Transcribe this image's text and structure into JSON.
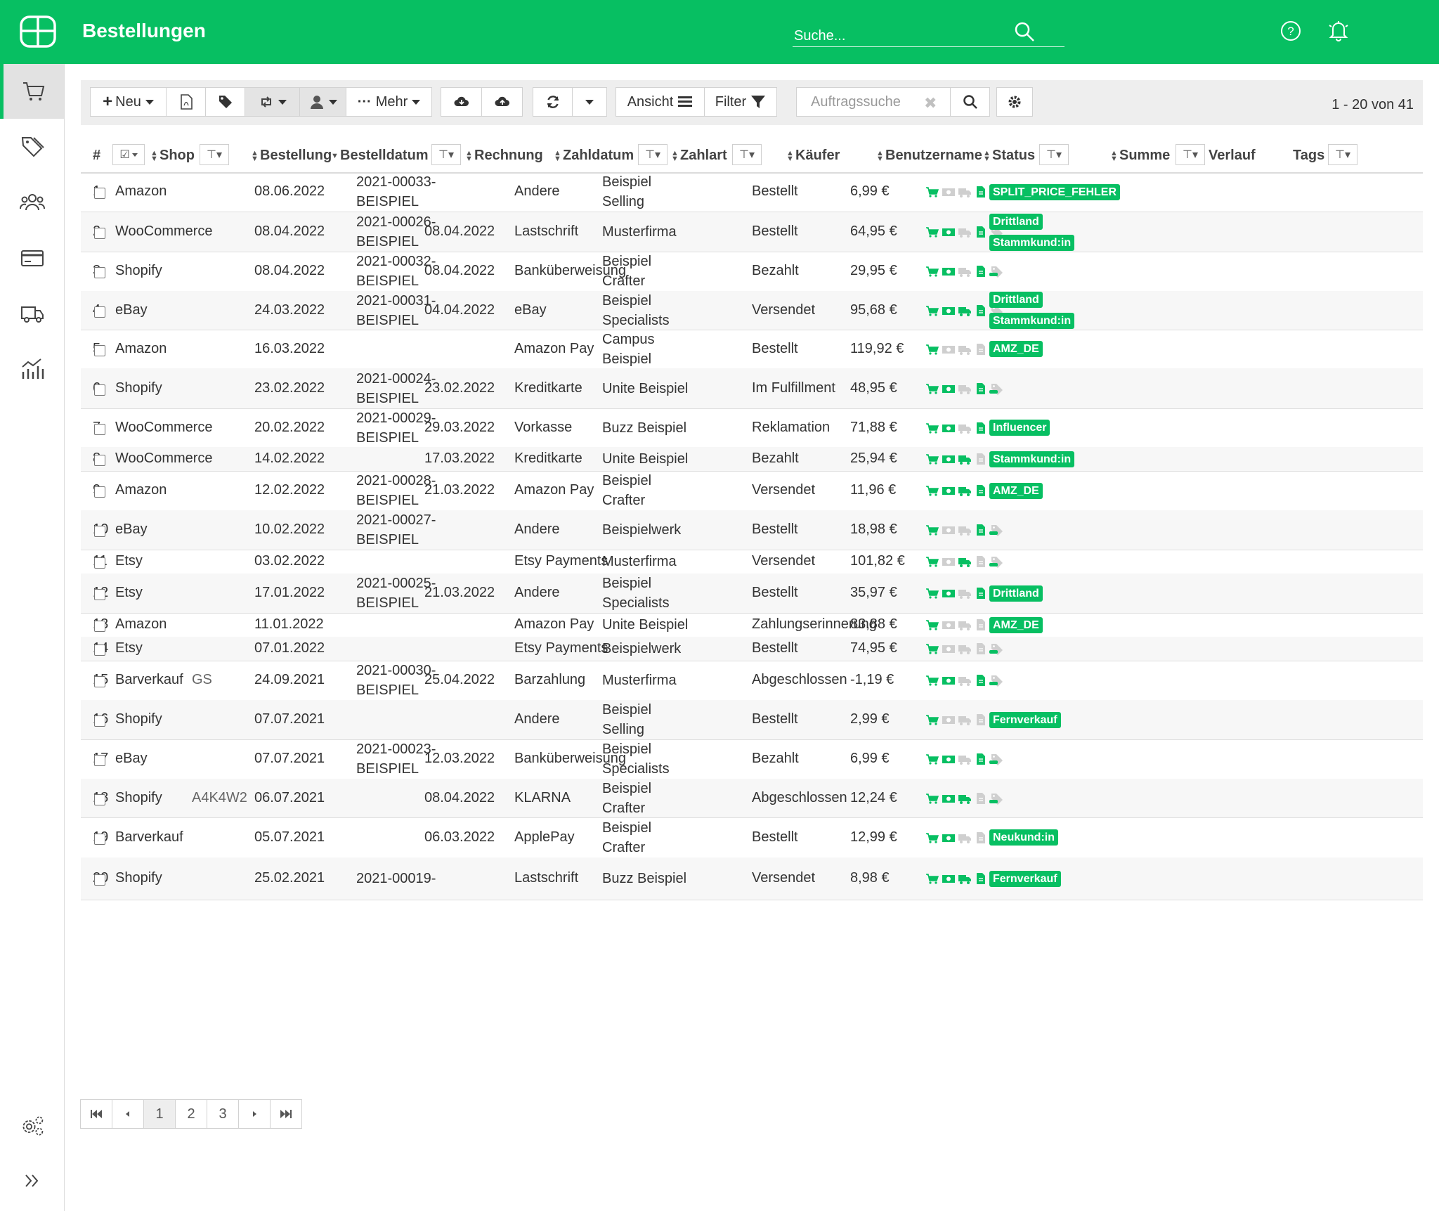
{
  "header": {
    "title": "Bestellungen",
    "search_placeholder": "Suche...",
    "brand_color": "#07bf62"
  },
  "sidebar": {
    "items": [
      "cart-icon",
      "tags-icon",
      "customers-icon",
      "payment-card-icon",
      "shipping-truck-icon",
      "analytics-icon"
    ],
    "bottom": [
      "settings-gears-icon",
      "expand-chevrons-icon"
    ]
  },
  "toolbar": {
    "new_label": "Neu",
    "more_label": "Mehr",
    "view_label": "Ansicht",
    "filter_label": "Filter",
    "order_search_placeholder": "Auftragssuche",
    "page_info": "1 - 20 von 41"
  },
  "columns": {
    "num": "#",
    "shop": "Shop",
    "order": "Bestellung",
    "order_date": "Bestelldatum",
    "invoice": "Rechnung",
    "pay_date": "Zahldatum",
    "pay_method": "Zahlart",
    "buyer": "Käufer",
    "username": "Benutzername",
    "status": "Status",
    "sum": "Summe",
    "history": "Verlauf",
    "tags": "Tags"
  },
  "rows": [
    {
      "n": "1",
      "shop": "Amazon",
      "order": "",
      "date": "08.06.2022",
      "inv1": "2021-00033-",
      "inv2": "BEISPIEL",
      "paydate": "",
      "method": "Andere",
      "buyer1": "Beispiel",
      "buyer2": "Selling",
      "user": "",
      "status": "Bestellt",
      "sum": "6,99 €",
      "v": [
        1,
        0,
        0,
        1,
        0
      ],
      "tags": [
        "SPLIT_PRICE_FEHLER"
      ]
    },
    {
      "n": "2",
      "shop": "WooCommerce",
      "order": "",
      "date": "08.04.2022",
      "inv1": "2021-00026-",
      "inv2": "BEISPIEL",
      "paydate": "08.04.2022",
      "method": "Lastschrift",
      "buyer1": "Musterfirma",
      "buyer2": "",
      "user": "",
      "status": "Bestellt",
      "sum": "64,95 €",
      "v": [
        1,
        1,
        0,
        1,
        0
      ],
      "tags": [
        "Drittland",
        "Stammkund:in"
      ]
    },
    {
      "n": "3",
      "shop": "Shopify",
      "order": "",
      "date": "08.04.2022",
      "inv1": "2021-00032-",
      "inv2": "BEISPIEL",
      "paydate": "08.04.2022",
      "method": "Banküberweisung",
      "buyer1": "Beispiel",
      "buyer2": "Crafter",
      "user": "",
      "status": "Bezahlt",
      "sum": "29,95 €",
      "v": [
        1,
        1,
        0,
        1,
        0
      ],
      "tags": []
    },
    {
      "n": "4",
      "shop": "eBay",
      "order": "",
      "date": "24.03.2022",
      "inv1": "2021-00031-",
      "inv2": "BEISPIEL",
      "paydate": "04.04.2022",
      "method": "eBay",
      "buyer1": "Beispiel",
      "buyer2": "Specialists",
      "user": "",
      "status": "Versendet",
      "sum": "95,68 €",
      "v": [
        1,
        1,
        1,
        1,
        0
      ],
      "tags": [
        "Drittland",
        "Stammkund:in"
      ]
    },
    {
      "n": "5",
      "shop": "Amazon",
      "order": "",
      "date": "16.03.2022",
      "inv1": "",
      "inv2": "",
      "paydate": "",
      "method": "Amazon Pay",
      "buyer1": "Campus",
      "buyer2": "Beispiel",
      "user": "",
      "status": "Bestellt",
      "sum": "119,92 €",
      "v": [
        1,
        0,
        0,
        0,
        0
      ],
      "tags": [
        "AMZ_DE"
      ]
    },
    {
      "n": "6",
      "shop": "Shopify",
      "order": "",
      "date": "23.02.2022",
      "inv1": "2021-00024-",
      "inv2": "BEISPIEL",
      "paydate": "23.02.2022",
      "method": "Kreditkarte",
      "buyer1": "Unite Beispiel",
      "buyer2": "",
      "user": "",
      "status": "Im Fulfillment",
      "sum": "48,95 €",
      "v": [
        1,
        1,
        0,
        1,
        0
      ],
      "tags": []
    },
    {
      "n": "7",
      "shop": "WooCommerce",
      "order": "",
      "date": "20.02.2022",
      "inv1": "2021-00029-",
      "inv2": "BEISPIEL",
      "paydate": "29.03.2022",
      "method": "Vorkasse",
      "buyer1": "Buzz Beispiel",
      "buyer2": "",
      "user": "",
      "status": "Reklamation",
      "sum": "71,88 €",
      "v": [
        1,
        1,
        0,
        1,
        0
      ],
      "tags": [
        "Influencer"
      ]
    },
    {
      "n": "8",
      "shop": "WooCommerce",
      "order": "",
      "date": "14.02.2022",
      "inv1": "",
      "inv2": "",
      "paydate": "17.03.2022",
      "method": "Kreditkarte",
      "buyer1": "Unite Beispiel",
      "buyer2": "",
      "user": "",
      "status": "Bezahlt",
      "sum": "25,94 €",
      "v": [
        1,
        1,
        1,
        0,
        0
      ],
      "tags": [
        "Stammkund:in"
      ]
    },
    {
      "n": "9",
      "shop": "Amazon",
      "order": "",
      "date": "12.02.2022",
      "inv1": "2021-00028-",
      "inv2": "BEISPIEL",
      "paydate": "21.03.2022",
      "method": "Amazon Pay",
      "buyer1": "Beispiel",
      "buyer2": "Crafter",
      "user": "",
      "status": "Versendet",
      "sum": "11,96 €",
      "v": [
        1,
        1,
        1,
        1,
        0
      ],
      "tags": [
        "AMZ_DE"
      ]
    },
    {
      "n": "10",
      "shop": "eBay",
      "order": "",
      "date": "10.02.2022",
      "inv1": "2021-00027-",
      "inv2": "BEISPIEL",
      "paydate": "",
      "method": "Andere",
      "buyer1": "Beispielwerk",
      "buyer2": "",
      "user": "",
      "status": "Bestellt",
      "sum": "18,98 €",
      "v": [
        1,
        0,
        0,
        1,
        0
      ],
      "tags": []
    },
    {
      "n": "11",
      "shop": "Etsy",
      "order": "",
      "date": "03.02.2022",
      "inv1": "",
      "inv2": "",
      "paydate": "",
      "method": "Etsy Payments",
      "buyer1": "Musterfirma",
      "buyer2": "",
      "user": "",
      "status": "Versendet",
      "sum": "101,82 €",
      "v": [
        1,
        0,
        1,
        0,
        0
      ],
      "tags": []
    },
    {
      "n": "12",
      "shop": "Etsy",
      "order": "",
      "date": "17.01.2022",
      "inv1": "2021-00025-",
      "inv2": "BEISPIEL",
      "paydate": "21.03.2022",
      "method": "Andere",
      "buyer1": "Beispiel",
      "buyer2": "Specialists",
      "user": "",
      "status": "Bestellt",
      "sum": "35,97 €",
      "v": [
        1,
        1,
        0,
        1,
        0
      ],
      "tags": [
        "Drittland"
      ]
    },
    {
      "n": "13",
      "shop": "Amazon",
      "order": "",
      "date": "11.01.2022",
      "inv1": "",
      "inv2": "",
      "paydate": "",
      "method": "Amazon Pay",
      "buyer1": "Unite Beispiel",
      "buyer2": "",
      "user": "",
      "status": "Zahlungserinnerung",
      "sum": "83,88 €",
      "v": [
        1,
        0,
        0,
        0,
        0
      ],
      "tags": [
        "AMZ_DE"
      ]
    },
    {
      "n": "14",
      "shop": "Etsy",
      "order": "",
      "date": "07.01.2022",
      "inv1": "",
      "inv2": "",
      "paydate": "",
      "method": "Etsy Payments",
      "buyer1": "Beispielwerk",
      "buyer2": "",
      "user": "",
      "status": "Bestellt",
      "sum": "74,95 €",
      "v": [
        1,
        0,
        0,
        0,
        0
      ],
      "tags": []
    },
    {
      "n": "15",
      "shop": "Barverkauf",
      "order": "GS",
      "date": "24.09.2021",
      "inv1": "2021-00030-",
      "inv2": "BEISPIEL",
      "paydate": "25.04.2022",
      "method": "Barzahlung",
      "buyer1": "Musterfirma",
      "buyer2": "",
      "user": "",
      "status": "Abgeschlossen",
      "sum": "-1,19 €",
      "v": [
        1,
        1,
        0,
        1,
        0
      ],
      "tags": []
    },
    {
      "n": "16",
      "shop": "Shopify",
      "order": "",
      "date": "07.07.2021",
      "inv1": "",
      "inv2": "",
      "paydate": "",
      "method": "Andere",
      "buyer1": "Beispiel",
      "buyer2": "Selling",
      "user": "",
      "status": "Bestellt",
      "sum": "2,99 €",
      "v": [
        1,
        0,
        0,
        0,
        0
      ],
      "tags": [
        "Fernverkauf"
      ]
    },
    {
      "n": "17",
      "shop": "eBay",
      "order": "",
      "date": "07.07.2021",
      "inv1": "2021-00023-",
      "inv2": "BEISPIEL",
      "paydate": "12.03.2022",
      "method": "Banküberweisung",
      "buyer1": "Beispiel",
      "buyer2": "Specialists",
      "user": "",
      "status": "Bezahlt",
      "sum": "6,99 €",
      "v": [
        1,
        1,
        0,
        1,
        0
      ],
      "tags": []
    },
    {
      "n": "18",
      "shop": "Shopify",
      "order": "A4K4W2",
      "date": "06.07.2021",
      "inv1": "",
      "inv2": "",
      "paydate": "08.04.2022",
      "method": "KLARNA",
      "buyer1": "Beispiel",
      "buyer2": "Crafter",
      "user": "",
      "status": "Abgeschlossen",
      "sum": "12,24 €",
      "v": [
        1,
        1,
        1,
        0,
        0
      ],
      "tags": []
    },
    {
      "n": "19",
      "shop": "Barverkauf",
      "order": "",
      "date": "05.07.2021",
      "inv1": "",
      "inv2": "",
      "paydate": "06.03.2022",
      "method": "ApplePay",
      "buyer1": "Beispiel",
      "buyer2": "Crafter",
      "user": "",
      "status": "Bestellt",
      "sum": "12,99 €",
      "v": [
        1,
        1,
        0,
        0,
        0
      ],
      "tags": [
        "Neukund:in"
      ]
    },
    {
      "n": "20",
      "shop": "Shopify",
      "order": "",
      "date": "25.02.2021",
      "inv1": "2021-00019-",
      "inv2": "",
      "paydate": "",
      "method": "Lastschrift",
      "buyer1": "Buzz Beispiel",
      "buyer2": "",
      "user": "",
      "status": "Versendet",
      "sum": "8,98 €",
      "v": [
        1,
        1,
        1,
        1,
        0
      ],
      "tags": [
        "Fernverkauf"
      ]
    }
  ],
  "pagination": {
    "pages": [
      "1",
      "2",
      "3"
    ],
    "current": "1"
  }
}
